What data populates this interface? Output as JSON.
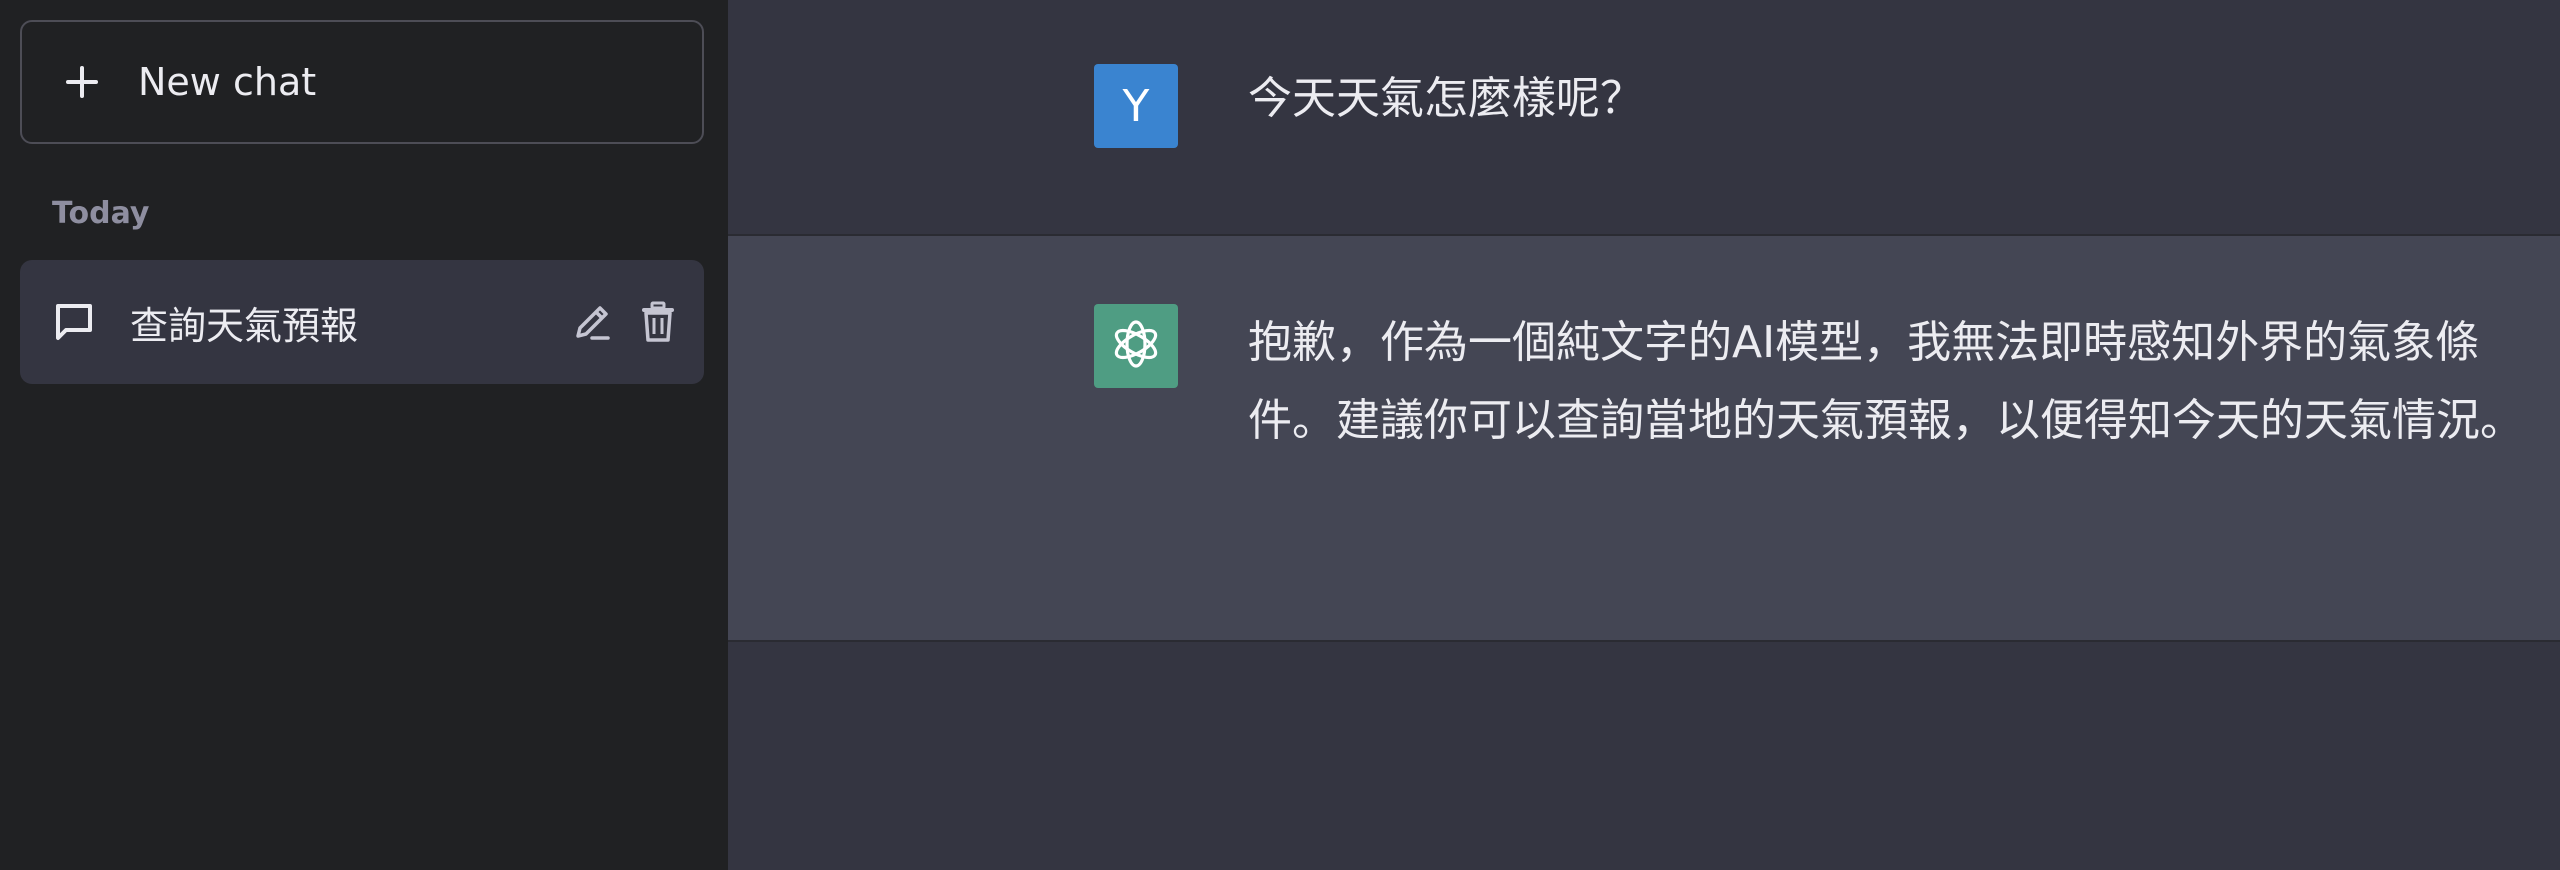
{
  "sidebar": {
    "new_chat_label": "New chat",
    "section_label": "Today",
    "items": [
      {
        "title": "查詢天氣預報"
      }
    ]
  },
  "conversation": {
    "user": {
      "avatar_letter": "Y",
      "text": "今天天氣怎麼樣呢？"
    },
    "assistant": {
      "text": "抱歉，作為一個純文字的AI模型，我無法即時感知外界的氣象條件。建議你可以查詢當地的天氣預報，以便得知今天的天氣情況。"
    }
  },
  "colors": {
    "sidebar_bg": "#202123",
    "main_bg": "#343541",
    "assistant_bg": "#444654",
    "user_avatar": "#3a84d0",
    "assistant_avatar": "#4f9d83"
  },
  "icons": {
    "new_chat": "plus-icon",
    "chat_item": "chat-bubble-icon",
    "edit": "pencil-icon",
    "delete": "trash-icon",
    "assistant_avatar": "openai-logo-icon"
  }
}
